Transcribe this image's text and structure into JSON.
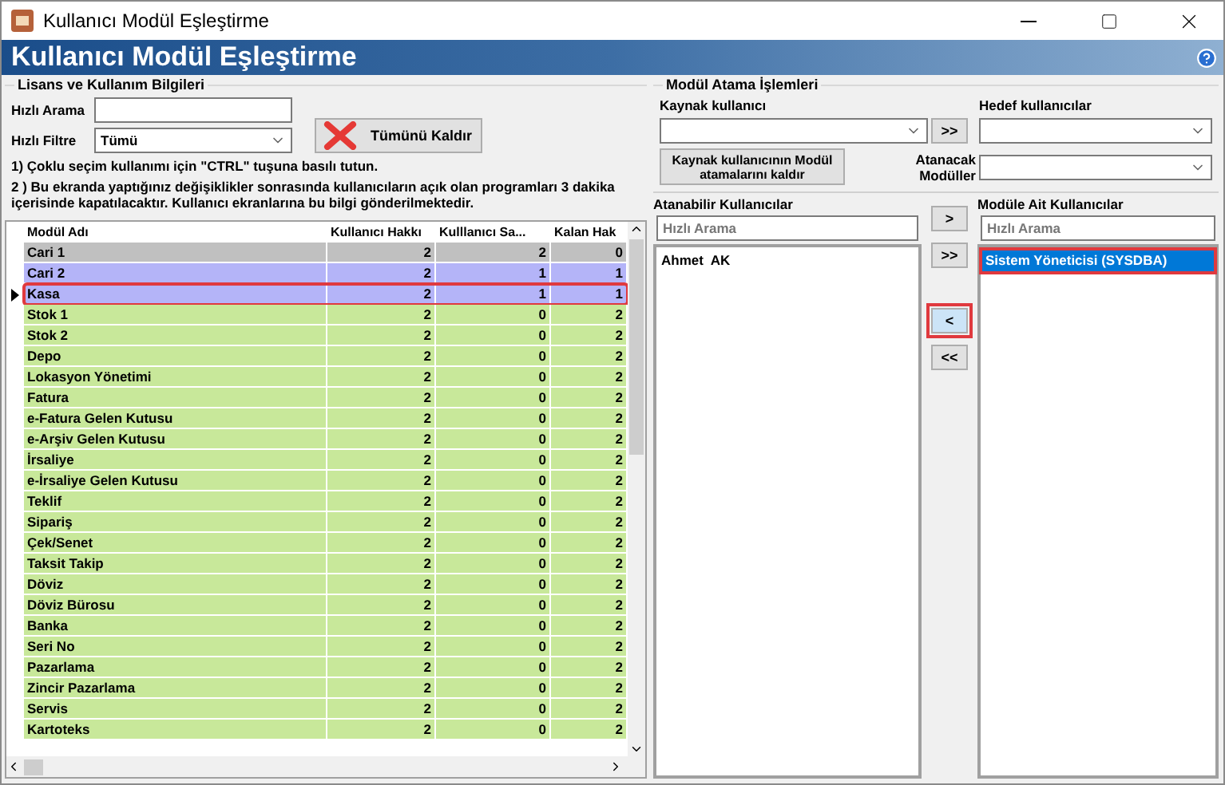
{
  "window": {
    "title": "Kullanıcı Modül Eşleştirme"
  },
  "banner": {
    "title": "Kullanıcı Modül Eşleştirme"
  },
  "license_panel": {
    "title": "Lisans ve Kullanım Bilgileri",
    "search_label": "Hızlı Arama",
    "filter_label": "Hızlı Filtre",
    "filter_value": "Tümü",
    "clear_button": "Tümünü Kaldır",
    "notes": [
      "1) Çoklu seçim kullanımı için \"CTRL\" tuşuna basılı tutun.",
      "2 ) Bu ekranda yaptığınız değişiklikler sonrasında kullanıcıların açık olan programları 3 dakika içerisinde kapatılacaktır. Kullanıcı ekranlarına bu bilgi gönderilmektedir."
    ]
  },
  "table": {
    "columns": [
      "Modül Adı",
      "Kullanıcı Hakkı",
      "Kulllanıcı Sa...",
      "Kalan Hak"
    ],
    "rows": [
      {
        "cells": [
          "Cari 1",
          "2",
          "2",
          "0"
        ],
        "color": "#c0c0c0",
        "selected": false
      },
      {
        "cells": [
          "Cari 2",
          "2",
          "1",
          "1"
        ],
        "color": "#b4b4f8",
        "selected": false
      },
      {
        "cells": [
          "Kasa",
          "2",
          "1",
          "1"
        ],
        "color": "#b4b4f8",
        "selected": true
      },
      {
        "cells": [
          "Stok 1",
          "2",
          "0",
          "2"
        ],
        "color": "#c8e89a",
        "selected": false
      },
      {
        "cells": [
          "Stok 2",
          "2",
          "0",
          "2"
        ],
        "color": "#c8e89a",
        "selected": false
      },
      {
        "cells": [
          "Depo",
          "2",
          "0",
          "2"
        ],
        "color": "#c8e89a",
        "selected": false
      },
      {
        "cells": [
          "Lokasyon Yönetimi",
          "2",
          "0",
          "2"
        ],
        "color": "#c8e89a",
        "selected": false
      },
      {
        "cells": [
          "Fatura",
          "2",
          "0",
          "2"
        ],
        "color": "#c8e89a",
        "selected": false
      },
      {
        "cells": [
          "e-Fatura Gelen Kutusu",
          "2",
          "0",
          "2"
        ],
        "color": "#c8e89a",
        "selected": false
      },
      {
        "cells": [
          "e-Arşiv Gelen Kutusu",
          "2",
          "0",
          "2"
        ],
        "color": "#c8e89a",
        "selected": false
      },
      {
        "cells": [
          "İrsaliye",
          "2",
          "0",
          "2"
        ],
        "color": "#c8e89a",
        "selected": false
      },
      {
        "cells": [
          "e-İrsaliye Gelen Kutusu",
          "2",
          "0",
          "2"
        ],
        "color": "#c8e89a",
        "selected": false
      },
      {
        "cells": [
          "Teklif",
          "2",
          "0",
          "2"
        ],
        "color": "#c8e89a",
        "selected": false
      },
      {
        "cells": [
          "Sipariş",
          "2",
          "0",
          "2"
        ],
        "color": "#c8e89a",
        "selected": false
      },
      {
        "cells": [
          "Çek/Senet",
          "2",
          "0",
          "2"
        ],
        "color": "#c8e89a",
        "selected": false
      },
      {
        "cells": [
          "Taksit Takip",
          "2",
          "0",
          "2"
        ],
        "color": "#c8e89a",
        "selected": false
      },
      {
        "cells": [
          "Döviz",
          "2",
          "0",
          "2"
        ],
        "color": "#c8e89a",
        "selected": false
      },
      {
        "cells": [
          "Döviz Bürosu",
          "2",
          "0",
          "2"
        ],
        "color": "#c8e89a",
        "selected": false
      },
      {
        "cells": [
          "Banka",
          "2",
          "0",
          "2"
        ],
        "color": "#c8e89a",
        "selected": false
      },
      {
        "cells": [
          "Seri No",
          "2",
          "0",
          "2"
        ],
        "color": "#c8e89a",
        "selected": false
      },
      {
        "cells": [
          "Pazarlama",
          "2",
          "0",
          "2"
        ],
        "color": "#c8e89a",
        "selected": false
      },
      {
        "cells": [
          "Zincir Pazarlama",
          "2",
          "0",
          "2"
        ],
        "color": "#c8e89a",
        "selected": false
      },
      {
        "cells": [
          "Servis",
          "2",
          "0",
          "2"
        ],
        "color": "#c8e89a",
        "selected": false
      },
      {
        "cells": [
          "Kartoteks",
          "2",
          "0",
          "2"
        ],
        "color": "#c8e89a",
        "selected": false
      }
    ]
  },
  "assign_panel": {
    "title": "Modül Atama İşlemleri",
    "source_label": "Kaynak kullanıcı",
    "copy_button": ">>",
    "target_label": "Hedef kullanıcılar",
    "remove_button": "Kaynak kullanıcının Modül atamalarını kaldır",
    "modules_label": "Atanacak Modüller",
    "available": {
      "label": "Atanabilir Kullanıcılar",
      "placeholder": "Hızlı Arama",
      "items": [
        {
          "name": "Ahmet  AK",
          "selected": false
        }
      ]
    },
    "move_buttons": [
      {
        "label": ">",
        "highlighted": false
      },
      {
        "label": ">>",
        "highlighted": false
      },
      {
        "label": "<",
        "highlighted": true
      },
      {
        "label": "<<",
        "highlighted": false
      }
    ],
    "assigned": {
      "label": "Modüle Ait Kullanıcılar",
      "placeholder": "Hızlı Arama",
      "items": [
        {
          "name": "Sistem Yöneticisi (SYSDBA)",
          "selected": true
        }
      ]
    }
  }
}
